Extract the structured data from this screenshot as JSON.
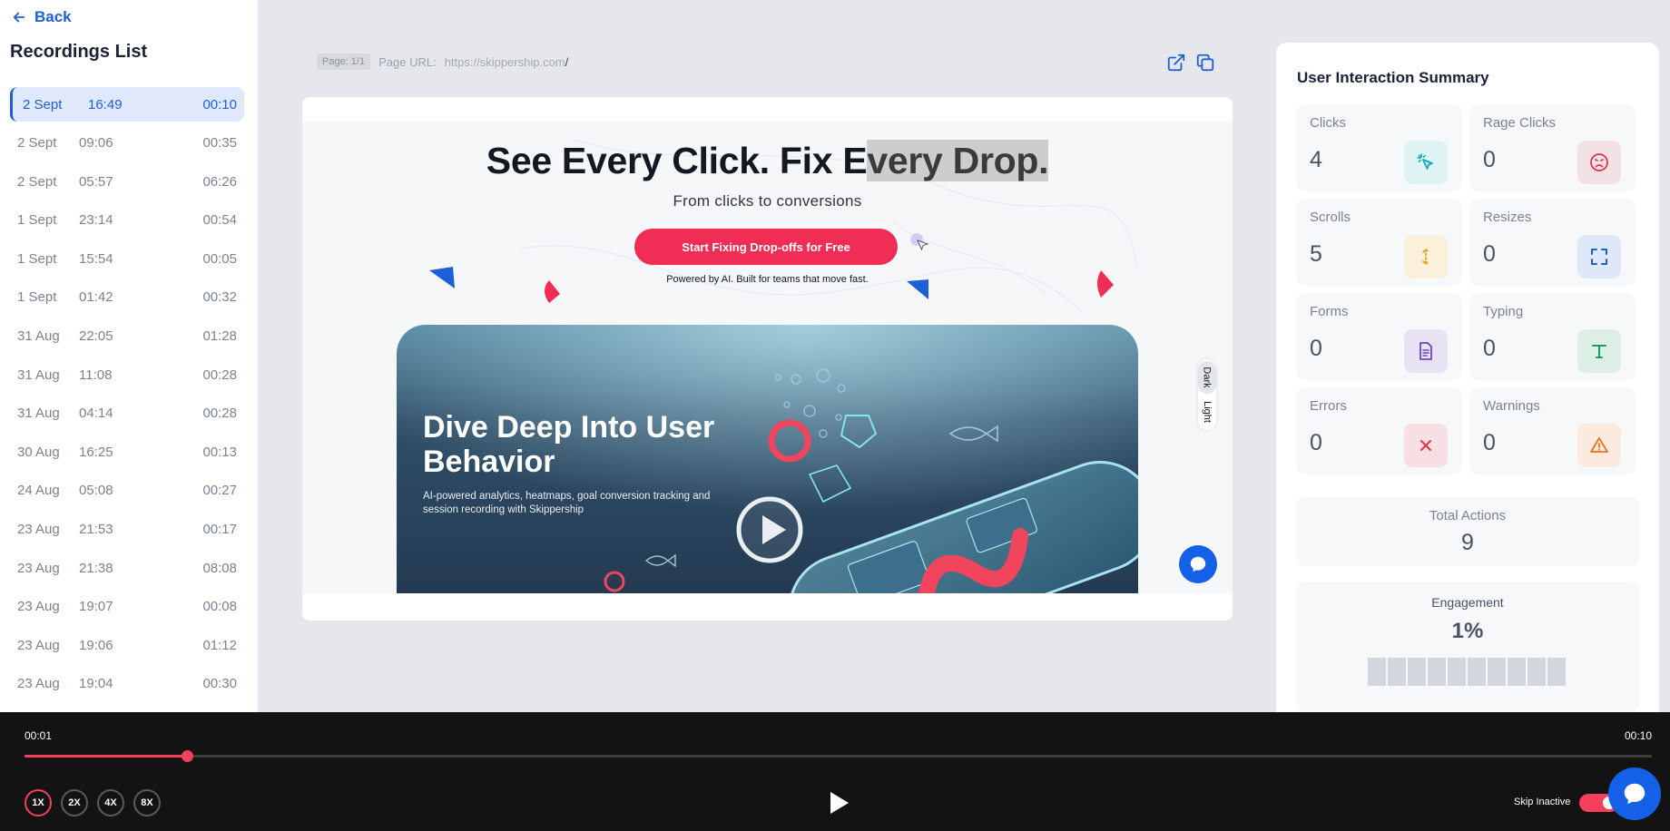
{
  "sidebar": {
    "back_label": "Back",
    "title": "Recordings List",
    "recordings": [
      {
        "date": "2 Sept",
        "time": "16:49",
        "duration": "00:10",
        "active": true
      },
      {
        "date": "2 Sept",
        "time": "09:06",
        "duration": "00:35"
      },
      {
        "date": "2 Sept",
        "time": "05:57",
        "duration": "06:26"
      },
      {
        "date": "1 Sept",
        "time": "23:14",
        "duration": "00:54"
      },
      {
        "date": "1 Sept",
        "time": "15:54",
        "duration": "00:05"
      },
      {
        "date": "1 Sept",
        "time": "01:42",
        "duration": "00:32"
      },
      {
        "date": "31 Aug",
        "time": "22:05",
        "duration": "01:28"
      },
      {
        "date": "31 Aug",
        "time": "11:08",
        "duration": "00:28"
      },
      {
        "date": "31 Aug",
        "time": "04:14",
        "duration": "00:28"
      },
      {
        "date": "30 Aug",
        "time": "16:25",
        "duration": "00:13"
      },
      {
        "date": "24 Aug",
        "time": "05:08",
        "duration": "00:27"
      },
      {
        "date": "23 Aug",
        "time": "21:53",
        "duration": "00:17"
      },
      {
        "date": "23 Aug",
        "time": "21:38",
        "duration": "08:08"
      },
      {
        "date": "23 Aug",
        "time": "19:07",
        "duration": "00:08"
      },
      {
        "date": "23 Aug",
        "time": "19:06",
        "duration": "01:12"
      },
      {
        "date": "23 Aug",
        "time": "19:04",
        "duration": "00:30"
      }
    ]
  },
  "viewer": {
    "page_badge": "Page: 1/1",
    "url_label": "Page URL:",
    "url_value": "https://skippership.com",
    "url_slash": "/",
    "actions": [
      "open-external-icon",
      "copy-icon"
    ]
  },
  "preview": {
    "headline_plain": "See Every Click. Fix E",
    "headline_highlight": "very Drop.",
    "subheadline": "From clicks to conversions",
    "cta": "Start Fixing Drop-offs for Free",
    "powered": "Powered by AI. Built for teams that move fast.",
    "video_title": "Dive Deep Into User Behavior",
    "video_desc": "AI-powered analytics, heatmaps, goal conversion tracking and session recording with Skippership",
    "theme_dark": "Dark",
    "theme_light": "Light"
  },
  "summary": {
    "title": "User Interaction Summary",
    "stats": [
      {
        "label": "Clicks",
        "value": "4",
        "icon": "cursor-click-icon",
        "bg": "#dff3f4",
        "fg": "#13a7b5"
      },
      {
        "label": "Rage Clicks",
        "value": "0",
        "icon": "angry-face-icon",
        "bg": "#f4e1e3",
        "fg": "#e0334e"
      },
      {
        "label": "Scrolls",
        "value": "5",
        "icon": "scroll-arrows-icon",
        "bg": "#fbf0da",
        "fg": "#e6a118"
      },
      {
        "label": "Resizes",
        "value": "0",
        "icon": "resize-frame-icon",
        "bg": "#dfe8f8",
        "fg": "#1d5fd6"
      },
      {
        "label": "Forms",
        "value": "0",
        "icon": "form-document-icon",
        "bg": "#e7e3f5",
        "fg": "#6b46c1"
      },
      {
        "label": "Typing",
        "value": "0",
        "icon": "text-t-icon",
        "bg": "#ddefe5",
        "fg": "#16a05a"
      },
      {
        "label": "Errors",
        "value": "0",
        "icon": "x-error-icon",
        "bg": "#f8dfe3",
        "fg": "#e0334e"
      },
      {
        "label": "Warnings",
        "value": "0",
        "icon": "warning-triangle-icon",
        "bg": "#fbeadd",
        "fg": "#e8741a"
      }
    ],
    "total_label": "Total Actions",
    "total_value": "9",
    "engagement_label": "Engagement",
    "engagement_value": "1%",
    "engagement_fraction": 0.01
  },
  "player": {
    "current_time": "00:01",
    "total_time": "00:10",
    "progress": 0.1,
    "speeds": [
      "1X",
      "2X",
      "4X",
      "8X"
    ],
    "active_speed": "1X",
    "skip_label": "Skip Inactive",
    "skip_on": true
  },
  "colors": {
    "accent": "#1d5fd6",
    "cta": "#ef2d55",
    "progress": "#f43f5e",
    "chat": "#1461e8"
  }
}
